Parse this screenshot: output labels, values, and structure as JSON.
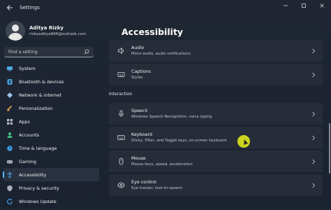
{
  "window": {
    "title": "Settings",
    "back_icon": "back-arrow-icon",
    "controls": [
      "minimize-icon",
      "maximize-icon",
      "close-icon"
    ]
  },
  "profile": {
    "name": "Aditya Rizky",
    "email": "rizkyaditya666@outlook.com"
  },
  "search": {
    "placeholder": "Find a setting"
  },
  "sidebar": {
    "items": [
      {
        "label": "System",
        "icon": "monitor-icon",
        "color": "#4aa8e8",
        "active": false
      },
      {
        "label": "Bluetooth & devices",
        "icon": "bluetooth-icon",
        "color": "#4aa8e8",
        "active": false
      },
      {
        "label": "Network & internet",
        "icon": "network-icon",
        "color": "#9cc2e8",
        "active": false
      },
      {
        "label": "Personalization",
        "icon": "brush-icon",
        "color": "#e6a356",
        "active": false
      },
      {
        "label": "Apps",
        "icon": "apps-icon",
        "color": "#b8b8c8",
        "active": false
      },
      {
        "label": "Accounts",
        "icon": "person-icon",
        "color": "#3fbf8a",
        "active": false
      },
      {
        "label": "Time & language",
        "icon": "globe-clock-icon",
        "color": "#3a9be0",
        "active": false
      },
      {
        "label": "Gaming",
        "icon": "gamepad-icon",
        "color": "#b8b8c8",
        "active": false
      },
      {
        "label": "Accessibility",
        "icon": "accessibility-icon",
        "color": "#4aa8e8",
        "active": true
      },
      {
        "label": "Privacy & security",
        "icon": "shield-icon",
        "color": "#a8b0bc",
        "active": false
      },
      {
        "label": "Windows Update",
        "icon": "update-icon",
        "color": "#3a9be0",
        "active": false
      }
    ]
  },
  "main": {
    "title": "Accessibility",
    "cards_top": [
      {
        "title": "Audio",
        "subtitle": "Mono audio, audio notifications",
        "icon": "speaker-icon"
      },
      {
        "title": "Captions",
        "subtitle": "Styles",
        "icon": "captions-icon"
      }
    ],
    "section_label": "Interaction",
    "cards_interaction": [
      {
        "title": "Speech",
        "subtitle": "Windows Speech Recognition, voice typing",
        "icon": "microphone-icon"
      },
      {
        "title": "Keyboard",
        "subtitle": "Sticky, Filter, and Toggle keys, on-screen keyboard",
        "icon": "keyboard-icon"
      },
      {
        "title": "Mouse",
        "subtitle": "Mouse keys, speed, acceleration",
        "icon": "mouse-icon"
      },
      {
        "title": "Eye control",
        "subtitle": "Eye tracker, text-to-speech",
        "icon": "eye-icon"
      }
    ]
  },
  "colors": {
    "accent": "#4cc2ff",
    "cursor_highlight": "#d9e21b"
  }
}
